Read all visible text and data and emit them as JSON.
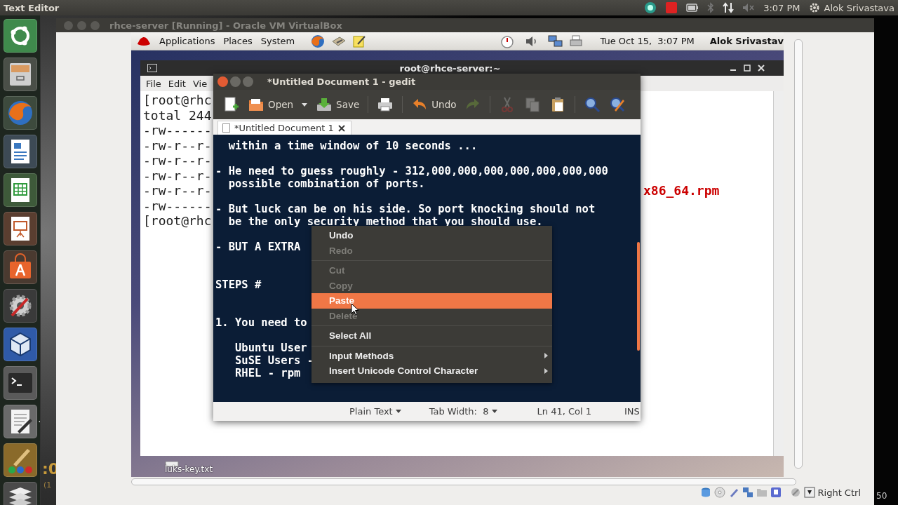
{
  "top_bar": {
    "app_title": "Text Editor",
    "clock": "3:07 PM",
    "user": "Alok Srivastava"
  },
  "launcher": {
    "items": [
      {
        "kind": "dash",
        "running": false
      },
      {
        "kind": "files",
        "running": false
      },
      {
        "kind": "browser",
        "running": false
      },
      {
        "kind": "writer",
        "running": false
      },
      {
        "kind": "calc",
        "running": false
      },
      {
        "kind": "impress",
        "running": false
      },
      {
        "kind": "software",
        "running": false
      },
      {
        "kind": "settings",
        "running": false
      },
      {
        "kind": "virtualbox",
        "running": false
      },
      {
        "kind": "terminal",
        "running": false
      },
      {
        "kind": "editor",
        "running": true
      },
      {
        "kind": "paint",
        "running": false
      },
      {
        "kind": "stack",
        "running": false
      }
    ]
  },
  "behind_texts": [
    ":0",
    "(1",
    "50"
  ],
  "vbox": {
    "title": "rhce-server [Running] - Oracle VM VirtualBox",
    "status_bar": {
      "host_key": "Right Ctrl"
    }
  },
  "guest": {
    "panel": {
      "menus": [
        "Applications",
        "Places",
        "System"
      ],
      "datetime": "Tue Oct 15,  3:07 PM",
      "user": "Alok Srivastav"
    },
    "desktop_icon": {
      "label": "luks-key.txt"
    },
    "terminal": {
      "title": "root@rhce-server:~",
      "menus": [
        "File",
        "Edit",
        "Vie"
      ],
      "lines": [
        {
          "text": "[root@rhc"
        },
        {
          "text": "total 244"
        },
        {
          "text": "-rw------"
        },
        {
          "text": "-rw-r--r-"
        },
        {
          "text": "-rw-r--r-"
        },
        {
          "text": "-rw-r--r-"
        },
        {
          "text": "-rw-r--r-",
          "highlight": "x86_64.rpm"
        },
        {
          "text": "-rw------"
        },
        {
          "text": "[root@rhc"
        }
      ]
    },
    "gedit": {
      "title": "*Untitled Document 1 - gedit",
      "toolbar": [
        {
          "kind": "new",
          "disabled": false
        },
        {
          "kind": "open",
          "label": "Open",
          "disabled": false
        },
        {
          "kind": "open_menu",
          "disabled": false
        },
        {
          "kind": "save",
          "label": "Save",
          "disabled": false
        },
        {
          "kind": "separator"
        },
        {
          "kind": "print",
          "disabled": false
        },
        {
          "kind": "separator"
        },
        {
          "kind": "undo",
          "label": "Undo",
          "disabled": false
        },
        {
          "kind": "redo",
          "disabled": true
        },
        {
          "kind": "separator"
        },
        {
          "kind": "cut",
          "disabled": true
        },
        {
          "kind": "copy",
          "disabled": true
        },
        {
          "kind": "paste",
          "disabled": false
        },
        {
          "kind": "separator"
        },
        {
          "kind": "find",
          "disabled": false
        },
        {
          "kind": "replace",
          "disabled": false
        }
      ],
      "tab": {
        "label": "*Untitled Document 1"
      },
      "blocks": [
        {
          "kind": "first",
          "lines": [
            "  within a time window of 10 seconds ..."
          ]
        },
        {
          "kind": "paragraph",
          "lines": [
            "- He need to guess roughly - 312,000,000,000,000,000,000,000",
            "  possible combination of ports."
          ]
        },
        {
          "kind": "paragraph",
          "lines": [
            "- But luck can be on his side. So port knocking should not",
            "  be the only security method that you should use."
          ]
        },
        {
          "kind": "paragraph",
          "lines": [
            "- BUT A EXTRA"
          ]
        },
        {
          "kind": "section",
          "lines": [
            "STEPS #"
          ]
        },
        {
          "kind": "section",
          "lines": [
            "1. You need to"
          ]
        },
        {
          "kind": "paragraph",
          "lines": [
            "   Ubuntu User",
            "   SuSE Users -",
            "   RHEL - rpm"
          ]
        }
      ],
      "status": {
        "language": "Plain Text",
        "tab_width": "Tab Width:  8",
        "position": "Ln 41, Col 1",
        "mode": "INS"
      }
    },
    "context_menu": {
      "items": [
        {
          "kind": "item",
          "label": "Undo",
          "disabled": false,
          "selected": false,
          "submenu": false
        },
        {
          "kind": "item",
          "label": "Redo",
          "disabled": true,
          "selected": false,
          "submenu": false
        },
        {
          "kind": "separator"
        },
        {
          "kind": "item",
          "label": "Cut",
          "disabled": true,
          "selected": false,
          "submenu": false
        },
        {
          "kind": "item",
          "label": "Copy",
          "disabled": true,
          "selected": false,
          "submenu": false
        },
        {
          "kind": "item",
          "label": "Paste",
          "disabled": false,
          "selected": true,
          "submenu": false
        },
        {
          "kind": "item",
          "label": "Delete",
          "disabled": true,
          "selected": false,
          "submenu": false
        },
        {
          "kind": "separator"
        },
        {
          "kind": "item",
          "label": "Select All",
          "disabled": false,
          "selected": false,
          "submenu": false
        },
        {
          "kind": "separator"
        },
        {
          "kind": "item",
          "label": "Input Methods",
          "disabled": false,
          "selected": false,
          "submenu": true
        },
        {
          "kind": "item",
          "label": "Insert Unicode Control Character",
          "disabled": false,
          "selected": false,
          "submenu": true
        }
      ]
    }
  }
}
